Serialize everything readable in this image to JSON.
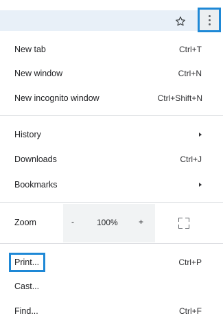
{
  "accent_color": "#1e88d6",
  "toolbar": {
    "bookmark_icon": "star-icon",
    "menu_icon": "three-dot-menu-icon"
  },
  "menu": {
    "new_tab": {
      "label": "New tab",
      "shortcut": "Ctrl+T"
    },
    "new_window": {
      "label": "New window",
      "shortcut": "Ctrl+N"
    },
    "new_incognito": {
      "label": "New incognito window",
      "shortcut": "Ctrl+Shift+N"
    },
    "history": {
      "label": "History"
    },
    "downloads": {
      "label": "Downloads",
      "shortcut": "Ctrl+J"
    },
    "bookmarks": {
      "label": "Bookmarks"
    },
    "zoom": {
      "label": "Zoom",
      "minus": "-",
      "value": "100%",
      "plus": "+"
    },
    "print": {
      "label": "Print...",
      "shortcut": "Ctrl+P"
    },
    "cast": {
      "label": "Cast..."
    },
    "find": {
      "label": "Find...",
      "shortcut": "Ctrl+F"
    }
  }
}
